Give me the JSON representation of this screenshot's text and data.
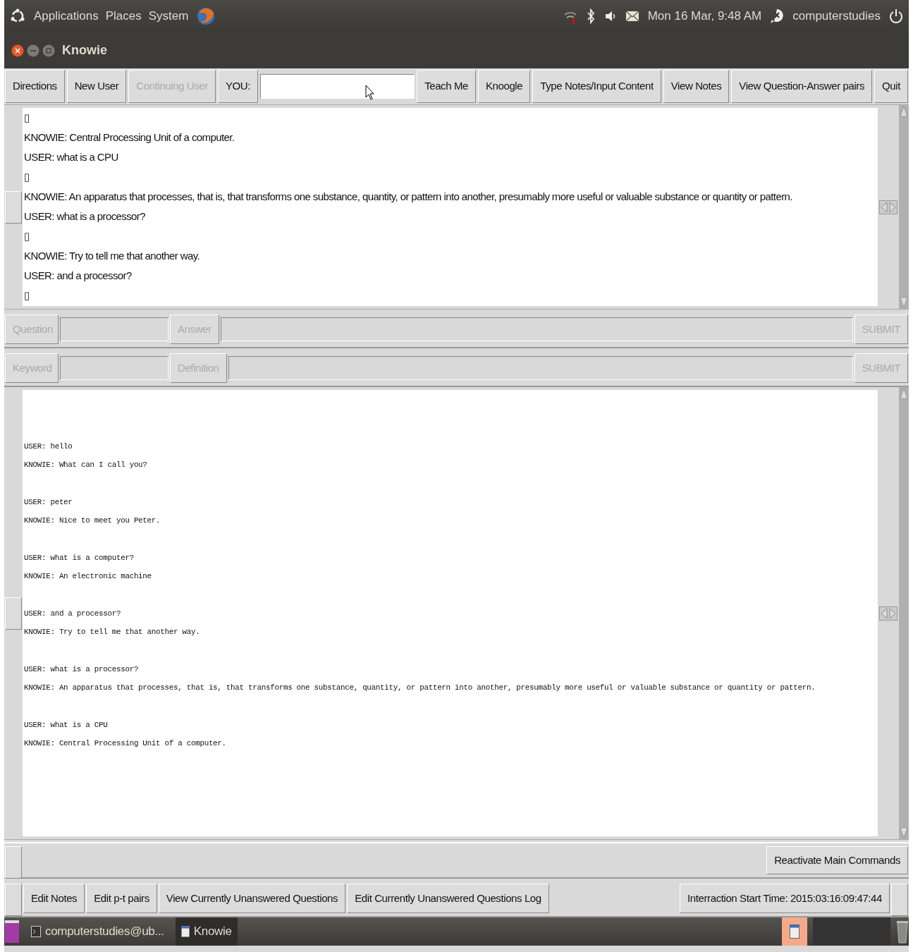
{
  "top_panel": {
    "menus": [
      "Applications",
      "Places",
      "System"
    ],
    "clock": "Mon 16 Mar, 9:48 AM",
    "user": "computerstudies"
  },
  "window": {
    "title": "Knowie"
  },
  "toolbar": [
    {
      "kind": "button",
      "label": "Directions",
      "disabled": false
    },
    {
      "kind": "button",
      "label": "New User",
      "disabled": false
    },
    {
      "kind": "button",
      "label": "Continuing User",
      "disabled": true
    },
    {
      "kind": "label",
      "label": "YOU:"
    },
    {
      "kind": "field"
    },
    {
      "kind": "button",
      "label": "Teach Me",
      "disabled": false
    },
    {
      "kind": "button",
      "label": "Knoogle",
      "disabled": false
    },
    {
      "kind": "button",
      "label": "Type Notes/Input Content",
      "disabled": false
    },
    {
      "kind": "button",
      "label": "View Notes",
      "disabled": false
    },
    {
      "kind": "button",
      "label": "View Question-Answer pairs",
      "disabled": false
    },
    {
      "kind": "button",
      "label": "Quit",
      "disabled": false
    }
  ],
  "transcript": [
    "▯",
    "KNOWIE: Central Processing Unit of a computer.",
    "USER: what is a CPU",
    "▯",
    "KNOWIE: An apparatus that processes, that is, that transforms one substance, quantity, or pattern into another, presumably more useful or valuable substance or quantity or pattern.",
    "USER: what is a processor?",
    "▯",
    "KNOWIE: Try to tell me that another way.",
    "USER: and a processor?",
    "▯"
  ],
  "teach_rows": [
    {
      "label_1": "Question",
      "label_2": "Answer",
      "submit": "SUBMIT",
      "disabled": true
    },
    {
      "label_1": "Keyword",
      "label_2": "Definition",
      "submit": "SUBMIT",
      "disabled": true
    }
  ],
  "chat_log": [
    [
      "USER: hello",
      "KNOWIE: What can I call you?"
    ],
    [
      "USER: peter",
      "KNOWIE: Nice to meet you Peter."
    ],
    [
      "USER: what is a computer?",
      "KNOWIE: An electronic machine"
    ],
    [
      "USER: and a processor?",
      "KNOWIE: Try to tell me that another way."
    ],
    [
      "USER: what is a processor?",
      "KNOWIE: An apparatus that processes, that is, that transforms one substance, quantity, or pattern into another, presumably more useful or valuable substance or quantity or pattern."
    ],
    [
      "USER: what is a CPU",
      "KNOWIE: Central Processing Unit of a computer."
    ]
  ],
  "reactivate_button": "Reactivate Main Commands",
  "bottom_buttons": [
    "Edit Notes",
    "Edit p-t pairs",
    "View Currently Unanswered Questions",
    "Edit Currently Unanswered Questions Log"
  ],
  "start_time": "Interraction Start Time: 2015:03:16:09:47:44",
  "taskbar": [
    {
      "label": "computerstudies@ub...",
      "kind": "terminal",
      "selected": false
    },
    {
      "label": "Knowie",
      "kind": "window",
      "selected": true
    }
  ]
}
